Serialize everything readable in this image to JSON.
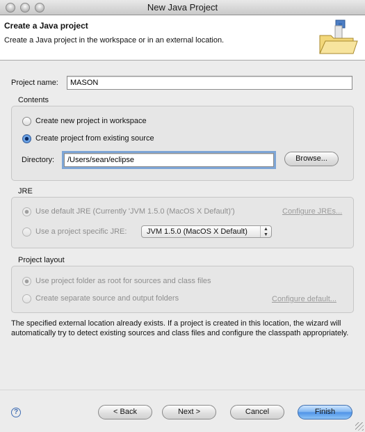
{
  "window": {
    "title": "New Java Project"
  },
  "header": {
    "title": "Create a Java project",
    "description": "Create a Java project in the workspace or in an external location."
  },
  "project_name": {
    "label": "Project name:",
    "value": "MASON"
  },
  "contents": {
    "title": "Contents",
    "option_new": "Create new project in workspace",
    "option_existing": "Create project from existing source",
    "selected": "option_existing",
    "directory_label": "Directory:",
    "directory_value": "/Users/sean/eclipse",
    "browse_label": "Browse..."
  },
  "jre": {
    "title": "JRE",
    "option_default": "Use default JRE (Currently 'JVM 1.5.0 (MacOS X Default)')",
    "configure_link": "Configure JREs...",
    "option_specific": "Use a project specific JRE:",
    "specific_value": "JVM 1.5.0 (MacOS X Default)"
  },
  "layout": {
    "title": "Project layout",
    "option_root": "Use project folder as root for sources and class files",
    "option_separate": "Create separate source and output folders",
    "configure_link": "Configure default..."
  },
  "info_message": "The specified external location already exists. If a project is created in this location, the wizard will automatically try to detect existing sources and class files and configure the classpath appropriately.",
  "buttons": {
    "help": "?",
    "back": "< Back",
    "next": "Next >",
    "cancel": "Cancel",
    "finish": "Finish"
  },
  "colors": {
    "default_button": "#6aa7ee",
    "focus_ring": "#7ea6d6"
  },
  "icons": [
    "new-java-project-folder-icon",
    "help-icon",
    "resize-grip-icon"
  ]
}
